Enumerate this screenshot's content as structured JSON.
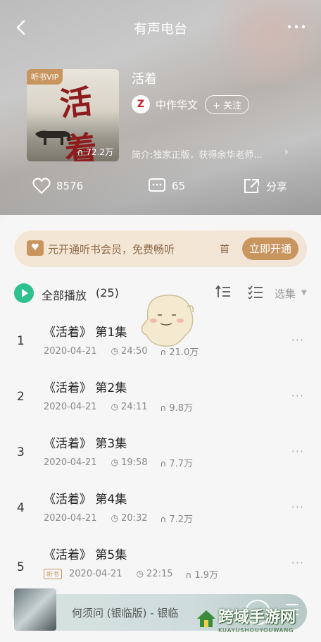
{
  "header": {
    "title": "有声电台",
    "back_icon": "back-chevron-icon",
    "more_icon": "more-dots-icon"
  },
  "album": {
    "vip_badge": "听书VIP",
    "cover_art_text": "活着",
    "play_count": "72.2万",
    "title": "活着",
    "publisher_logo": "Z",
    "publisher": "中作华文",
    "follow_label": "+ 关注",
    "intro": "简介:独家正版，获得余华老师..."
  },
  "actions": {
    "likes": "8576",
    "comments": "65",
    "share_label": "分享"
  },
  "vip_banner": {
    "icon_glyph": "♥",
    "text": "元开通听书会员，免费畅听",
    "extra": "首",
    "button": "立即开通"
  },
  "list_header": {
    "play_all_label": "全部播放",
    "count": "(25)",
    "select_label": "选集"
  },
  "episodes": [
    {
      "num": "1",
      "title": "《活着》 第1集",
      "date": "2020-04-21",
      "duration": "24:50",
      "plays": "21.0万",
      "tag": ""
    },
    {
      "num": "2",
      "title": "《活着》 第2集",
      "date": "2020-04-21",
      "duration": "24:11",
      "plays": "9.8万",
      "tag": ""
    },
    {
      "num": "3",
      "title": "《活着》 第3集",
      "date": "2020-04-21",
      "duration": "19:58",
      "plays": "7.7万",
      "tag": ""
    },
    {
      "num": "4",
      "title": "《活着》 第4集",
      "date": "2020-04-21",
      "duration": "20:32",
      "plays": "7.2万",
      "tag": ""
    },
    {
      "num": "5",
      "title": "《活着》 第5集",
      "date": "2020-04-21",
      "duration": "22:15",
      "plays": "1.9万",
      "tag": "听书"
    }
  ],
  "mini_player": {
    "title": "何须问 (银临版) - 银临"
  },
  "watermark": {
    "title": "跨域手游网",
    "subtitle": "KUAYUSHOUYOUWANG"
  },
  "colors": {
    "accent_green": "#2fc08f",
    "vip_gold": "#c9955f"
  }
}
